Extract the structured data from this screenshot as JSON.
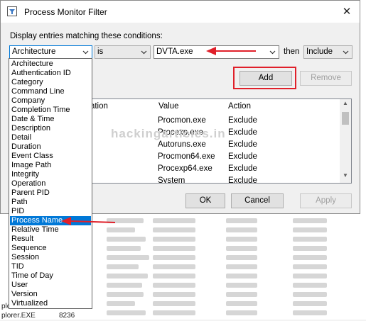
{
  "dialog": {
    "title": "Process Monitor Filter",
    "close_glyph": "✕",
    "conditions_label": "Display entries matching these conditions:",
    "column_value": "Architecture",
    "relation_value": "is",
    "value_input": "DVTA.exe",
    "then_label": "then",
    "action_value": "Include",
    "add_label": "Add",
    "remove_label": "Remove",
    "ok_label": "OK",
    "cancel_label": "Cancel",
    "apply_label": "Apply",
    "rules_headers": [
      "elation",
      "Value",
      "Action"
    ],
    "rules": [
      {
        "value": "Procmon.exe",
        "action": "Exclude"
      },
      {
        "value": "Procexp.exe",
        "action": "Exclude"
      },
      {
        "value": "Autoruns.exe",
        "action": "Exclude"
      },
      {
        "value": "Procmon64.exe",
        "action": "Exclude"
      },
      {
        "value": "Procexp64.exe",
        "action": "Exclude"
      },
      {
        "value": "System",
        "action": "Exclude"
      }
    ],
    "watermark": "hackingarticles.in"
  },
  "dropdown": {
    "items": [
      "Architecture",
      "Authentication ID",
      "Category",
      "Command Line",
      "Company",
      "Completion Time",
      "Date & Time",
      "Description",
      "Detail",
      "Duration",
      "Event Class",
      "Image Path",
      "Integrity",
      "Operation",
      "Parent PID",
      "Path",
      "PID",
      "Process Name",
      "Relative Time",
      "Result",
      "Sequence",
      "Session",
      "TID",
      "Time of Day",
      "User",
      "Version",
      "Virtualized"
    ],
    "selected": "Process Name"
  },
  "background": {
    "rows": [
      {
        "left": "plorer.EXE",
        "pid": "8236"
      },
      {
        "left": "plorer.EXE",
        "pid": "8236"
      }
    ]
  },
  "colors": {
    "accent": "#0078d7",
    "annotation": "#e0202a"
  }
}
